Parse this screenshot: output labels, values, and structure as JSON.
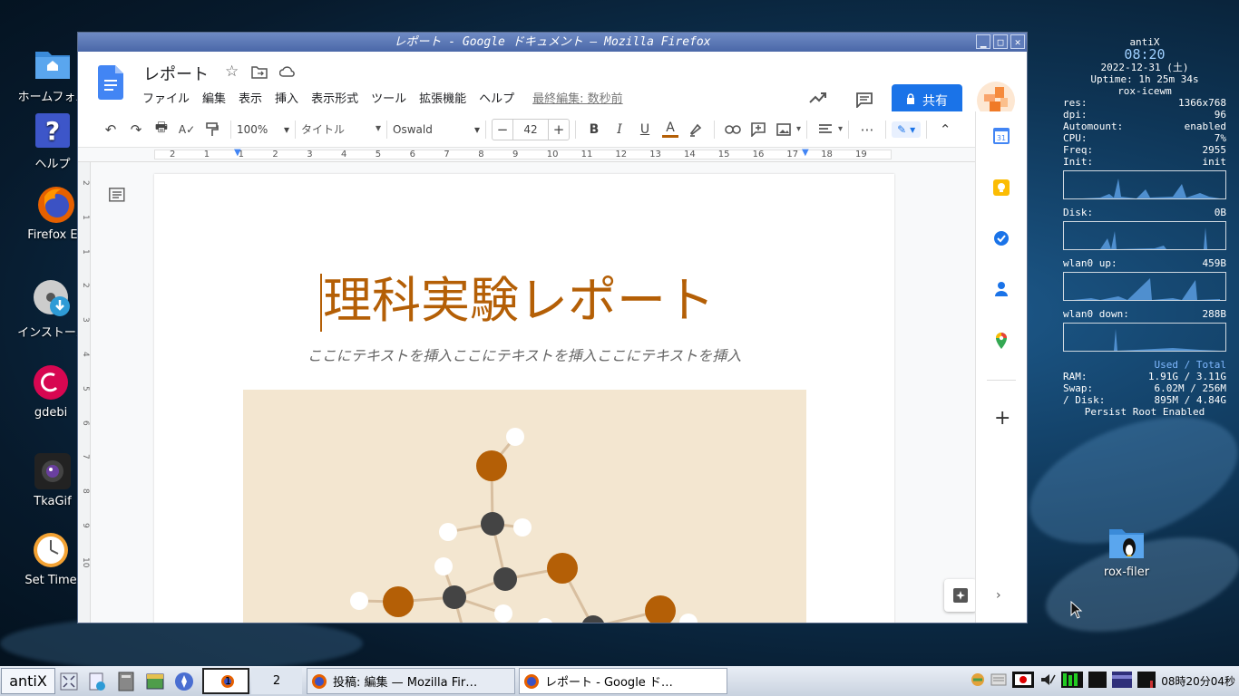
{
  "desktop": {
    "icons": [
      {
        "label": "ホームフォル"
      },
      {
        "label": "ヘルプ"
      },
      {
        "label": "Firefox ES"
      },
      {
        "label": "インストール"
      },
      {
        "label": "gdebi"
      },
      {
        "label": "TkaGif"
      },
      {
        "label": "Set Time"
      },
      {
        "label": "rox-filer"
      }
    ]
  },
  "conky": {
    "distro": "antiX",
    "time": "08:20",
    "date": "2022-12-31 (土)",
    "uptime": "Uptime: 1h 25m 34s",
    "wm": "rox-icewm",
    "stats": [
      {
        "k": "res:",
        "v": "1366x768"
      },
      {
        "k": "dpi:",
        "v": "96"
      },
      {
        "k": "Automount:",
        "v": "enabled"
      },
      {
        "k": "CPU:",
        "v": "7%"
      },
      {
        "k": "Freq:",
        "v": "2955"
      },
      {
        "k": "Init:",
        "v": "init"
      }
    ],
    "disk_label": "Disk:",
    "disk_val": "0B",
    "up_label": "wlan0 up:",
    "up_val": "459B",
    "down_label": "wlan0 down:",
    "down_val": "288B",
    "used_total": "Used / Total",
    "ram_k": "RAM:",
    "ram_v": "1.91G / 3.11G",
    "swap_k": "Swap:",
    "swap_v": "6.02M / 256M",
    "disk2_k": "/ Disk:",
    "disk2_v": "895M  / 4.84G",
    "persist": "Persist Root Enabled"
  },
  "window": {
    "title": "レポート - Google ドキュメント — Mozilla Firefox"
  },
  "docs": {
    "doc_title": "レポート",
    "menus": [
      "ファイル",
      "編集",
      "表示",
      "挿入",
      "表示形式",
      "ツール",
      "拡張機能",
      "ヘルプ"
    ],
    "last_edit": "最終編集: 数秒前",
    "share_label": "共有",
    "zoom": "100%",
    "style": "タイトル",
    "font": "Oswald",
    "font_size": "42",
    "bold": "B",
    "italic": "I",
    "underline": "U",
    "text_color_glyph": "A",
    "ruler_marks": [
      "2",
      "1",
      "1",
      "2",
      "3",
      "4",
      "5",
      "6",
      "7",
      "8",
      "9",
      "10",
      "11",
      "12",
      "13",
      "14",
      "15",
      "16",
      "17",
      "18",
      "19"
    ],
    "vruler_marks": [
      "2",
      "1",
      "1",
      "2",
      "3",
      "4",
      "5",
      "6",
      "7",
      "8",
      "9",
      "10"
    ],
    "page_title": "理科実験レポート",
    "page_subtitle": "ここにテキストを挿入ここにテキストを挿入ここにテキストを挿入",
    "accent": "#b45f06",
    "calendar_day": "31"
  },
  "taskbar": {
    "start_label": "antiX",
    "workspace1": "1",
    "workspace2": "2",
    "task1": "投稿: 編集 — Mozilla Fir…",
    "task2": "レポート - Google ド…",
    "clock": "08時20分04秒"
  }
}
